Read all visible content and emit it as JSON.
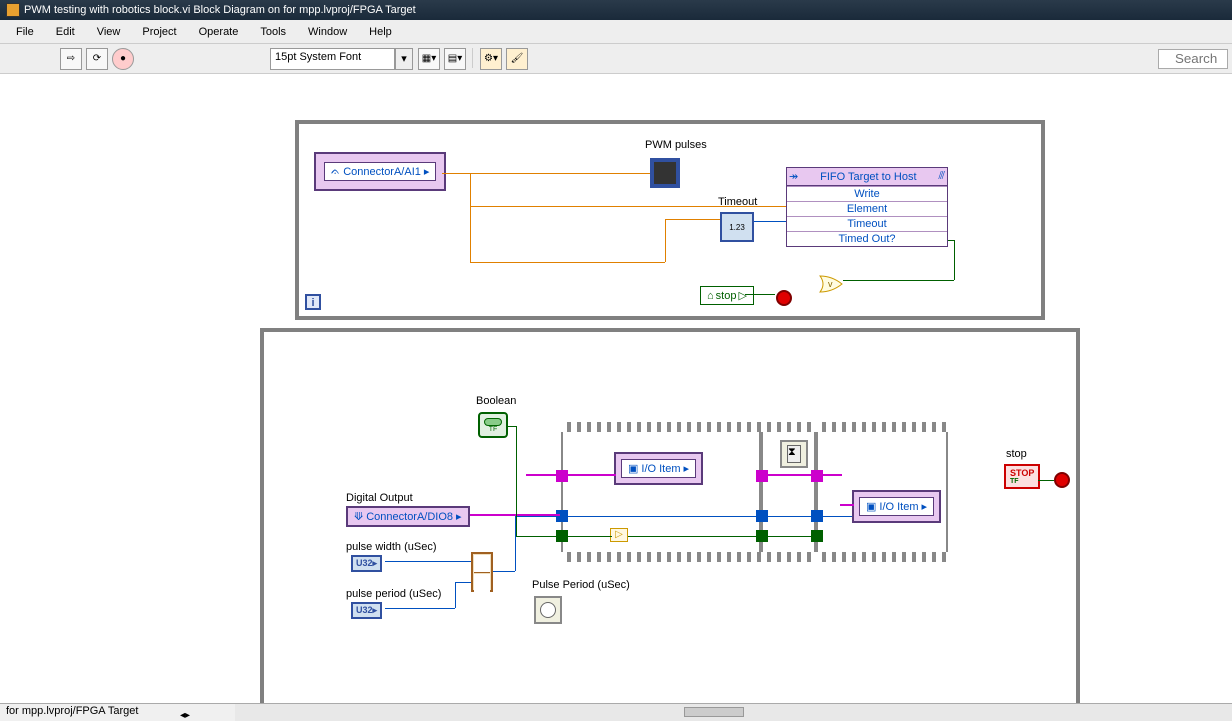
{
  "window": {
    "title": "PWM testing  with robotics block.vi Block Diagram on for mpp.lvproj/FPGA Target"
  },
  "menus": [
    "File",
    "Edit",
    "View",
    "Project",
    "Operate",
    "Tools",
    "Window",
    "Help"
  ],
  "toolbar": {
    "font": "15pt System Font",
    "search_placeholder": "Search"
  },
  "nodes": {
    "connectorA": "ConnectorA/AI1",
    "pwm_pulses": "PWM pulses",
    "timeout": "Timeout",
    "fifo": {
      "title": "FIFO Target to Host",
      "rows": [
        "Write",
        "Element",
        "Timeout",
        "Timed Out?"
      ]
    },
    "stop_ctrl": "stop",
    "boolean_label": "Boolean",
    "digital_out_label": "Digital Output",
    "digital_out_value": "ConnectorA/DIO8",
    "pulse_width_label": "pulse width (uSec)",
    "pulse_period_label": "pulse period (uSec)",
    "pulse_period_ind": "Pulse Period (uSec)",
    "io_item": "I/O Item",
    "stop2": "stop",
    "u32": "U32",
    "const_123": "1.23",
    "stop_btn": "STOP"
  },
  "tab": "for mpp.lvproj/FPGA Target",
  "icons": {
    "home": "⌂",
    "play": "▷",
    "wave": "ᨊ"
  }
}
